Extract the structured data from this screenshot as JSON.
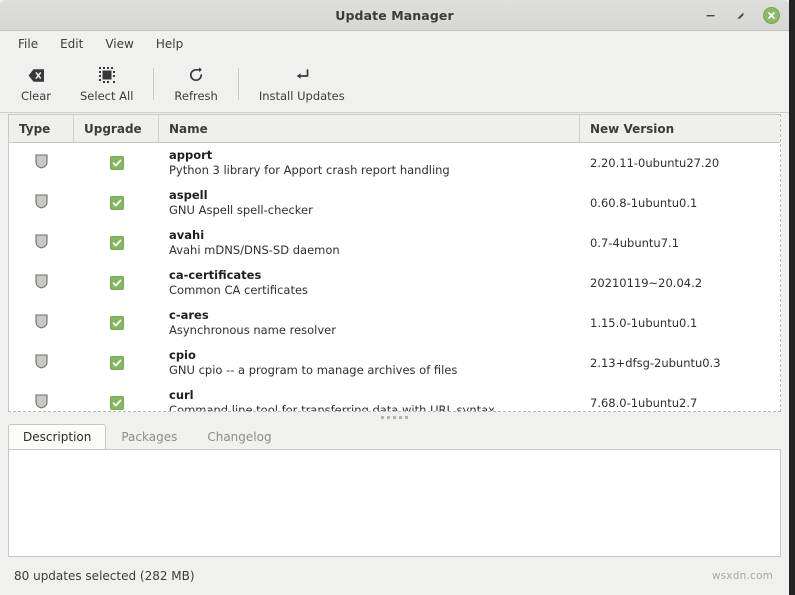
{
  "window": {
    "title": "Update Manager",
    "controls": [
      {
        "name": "minimize",
        "glyph": "minimize-icon"
      },
      {
        "name": "maximize",
        "glyph": "maximize-icon"
      },
      {
        "name": "close",
        "glyph": "close-icon"
      }
    ]
  },
  "menubar": {
    "items": [
      {
        "label": "File"
      },
      {
        "label": "Edit"
      },
      {
        "label": "View"
      },
      {
        "label": "Help"
      }
    ]
  },
  "toolbar": {
    "clear_label": "Clear",
    "select_all_label": "Select All",
    "refresh_label": "Refresh",
    "install_updates_label": "Install Updates",
    "icons": {
      "clear": "clear-icon",
      "select_all": "select-all-icon",
      "refresh": "refresh-icon",
      "install_updates": "install-updates-icon"
    }
  },
  "list": {
    "columns": [
      {
        "label": "Type"
      },
      {
        "label": "Upgrade"
      },
      {
        "label": "Name"
      },
      {
        "label": "New Version"
      }
    ],
    "rows": [
      {
        "type_icon": "shield-icon",
        "upgrade_checked": true,
        "name": "apport",
        "description": "Python 3 library for Apport crash report handling",
        "new_version": "2.20.11-0ubuntu27.20"
      },
      {
        "type_icon": "shield-icon",
        "upgrade_checked": true,
        "name": "aspell",
        "description": "GNU Aspell spell-checker",
        "new_version": "0.60.8-1ubuntu0.1"
      },
      {
        "type_icon": "shield-icon",
        "upgrade_checked": true,
        "name": "avahi",
        "description": "Avahi mDNS/DNS-SD daemon",
        "new_version": "0.7-4ubuntu7.1"
      },
      {
        "type_icon": "shield-icon",
        "upgrade_checked": true,
        "name": "ca-certificates",
        "description": "Common CA certificates",
        "new_version": "20210119~20.04.2"
      },
      {
        "type_icon": "shield-icon",
        "upgrade_checked": true,
        "name": "c-ares",
        "description": "Asynchronous name resolver",
        "new_version": "1.15.0-1ubuntu0.1"
      },
      {
        "type_icon": "shield-icon",
        "upgrade_checked": true,
        "name": "cpio",
        "description": "GNU cpio -- a program to manage archives of files",
        "new_version": "2.13+dfsg-2ubuntu0.3"
      },
      {
        "type_icon": "shield-icon",
        "upgrade_checked": true,
        "name": "curl",
        "description": "Command line tool for transferring data with URL syntax",
        "new_version": "7.68.0-1ubuntu2.7"
      }
    ]
  },
  "tabs": [
    {
      "label": "Description",
      "active": true
    },
    {
      "label": "Packages",
      "active": false
    },
    {
      "label": "Changelog",
      "active": false
    }
  ],
  "description_panel": {
    "content": ""
  },
  "statusbar": {
    "text": "80 updates selected (282 MB)",
    "watermark": "wsxdn.com"
  },
  "colors": {
    "window_bg": "#f0f0ef",
    "titlebar_bg": "#dededa",
    "accent_green": "#88b764",
    "close_button": "#8cb867",
    "text": "#3c3c39",
    "list_bg": "#ffffff"
  }
}
